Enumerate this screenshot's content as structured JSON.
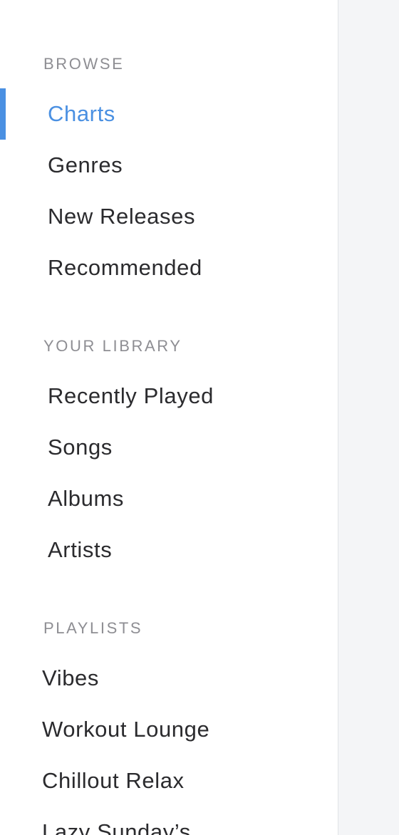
{
  "sidebar": {
    "browse": {
      "heading": "BROWSE",
      "items": [
        {
          "label": "Charts",
          "active": true
        },
        {
          "label": "Genres"
        },
        {
          "label": "New Releases"
        },
        {
          "label": "Recommended"
        }
      ]
    },
    "library": {
      "heading": "YOUR LIBRARY",
      "items": [
        {
          "label": "Recently Played"
        },
        {
          "label": "Songs"
        },
        {
          "label": "Albums"
        },
        {
          "label": "Artists"
        }
      ]
    },
    "playlists": {
      "heading": "PLAYLISTS",
      "items": [
        {
          "label": "Vibes"
        },
        {
          "label": "Workout Lounge"
        },
        {
          "label": "Chillout Relax"
        },
        {
          "label": "Lazy Sunday’s"
        }
      ]
    }
  },
  "colors": {
    "accent": "#4a90e2",
    "heading": "#8e8e93",
    "text": "#2b2b2e",
    "content_background": "#f4f5f7"
  }
}
